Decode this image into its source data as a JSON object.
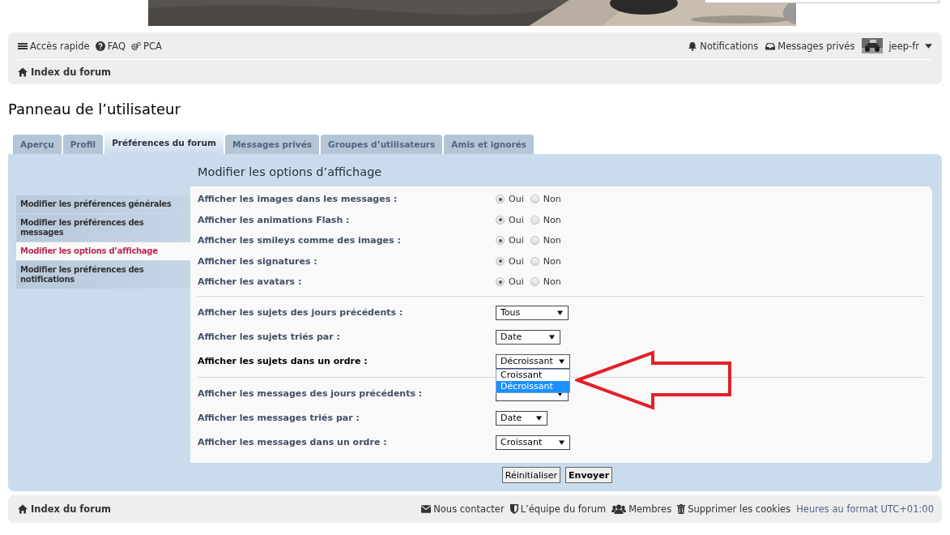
{
  "nav": {
    "quick_links": [
      {
        "label": "Accès rapide"
      },
      {
        "label": "FAQ"
      },
      {
        "label": "PCA"
      }
    ],
    "notifications": {
      "label": "Notifications"
    },
    "private_messages": {
      "label": "Messages privés"
    },
    "user": {
      "name": "jeep-fr"
    },
    "breadcrumb": "Index du forum"
  },
  "page_title": "Panneau de l’utilisateur",
  "tabs": [
    {
      "label": "Aperçu",
      "selected": false
    },
    {
      "label": "Profil",
      "selected": false
    },
    {
      "label": "Préférences du forum",
      "selected": true
    },
    {
      "label": "Messages privés",
      "selected": false
    },
    {
      "label": "Groupes d’utilisateurs",
      "selected": false
    },
    {
      "label": "Amis et ignorés",
      "selected": false
    }
  ],
  "sidebar": {
    "items": [
      {
        "label": "Modifier les préférences générales",
        "selected": false
      },
      {
        "label": "Modifier les préférences des messages",
        "selected": false
      },
      {
        "label": "Modifier les options d’affichage",
        "selected": true
      },
      {
        "label": "Modifier les préférences des notifications",
        "selected": false
      }
    ]
  },
  "heading": "Modifier les options d’affichage",
  "sections": [
    {
      "rows": [
        {
          "kind": "radio",
          "label": "Afficher les images dans les messages :",
          "options": [
            {
              "label": "Oui",
              "selected": true
            },
            {
              "label": "Non",
              "selected": false
            }
          ]
        },
        {
          "kind": "radio",
          "label": "Afficher les animations Flash :",
          "options": [
            {
              "label": "Oui",
              "selected": true
            },
            {
              "label": "Non",
              "selected": false
            }
          ]
        },
        {
          "kind": "radio",
          "label": "Afficher les smileys comme des images :",
          "options": [
            {
              "label": "Oui",
              "selected": true
            },
            {
              "label": "Non",
              "selected": false
            }
          ]
        },
        {
          "kind": "radio",
          "label": "Afficher les signatures :",
          "options": [
            {
              "label": "Oui",
              "selected": true
            },
            {
              "label": "Non",
              "selected": false
            }
          ]
        },
        {
          "kind": "radio",
          "label": "Afficher les avatars :",
          "options": [
            {
              "label": "Oui",
              "selected": true
            },
            {
              "label": "Non",
              "selected": false
            }
          ]
        }
      ]
    },
    {
      "rows": [
        {
          "kind": "select",
          "label": "Afficher les sujets des jours précédents :",
          "value": "Tous",
          "expanded": false
        },
        {
          "kind": "select",
          "label": "Afficher les sujets triés par :",
          "value": "Date",
          "expanded": false
        },
        {
          "kind": "select",
          "label": "Afficher les sujets dans un ordre :",
          "value": "Décroissant",
          "expanded": true,
          "options": [
            {
              "label": "Croissant",
              "selected": false
            },
            {
              "label": "Décroissant",
              "selected": true
            }
          ]
        }
      ]
    },
    {
      "rows": [
        {
          "kind": "select",
          "label": "Afficher les messages des jours précédents :",
          "expanded": false
        },
        {
          "kind": "select",
          "label": "Afficher les messages triés par :",
          "value": "Date",
          "expanded": false
        },
        {
          "kind": "select",
          "label": "Afficher les messages dans un ordre :",
          "value": "Croissant",
          "expanded": false
        }
      ]
    }
  ],
  "buttons": [
    {
      "label": "Réinitialiser",
      "kind": "reset"
    },
    {
      "label": "Envoyer",
      "kind": "submit"
    }
  ],
  "footer": {
    "breadcrumb": "Index du forum",
    "links": [
      {
        "label": "Nous contacter"
      },
      {
        "label": "L’équipe du forum"
      },
      {
        "label": "Membres"
      },
      {
        "label": "Supprimer les cookies"
      }
    ],
    "timezone": "Heures au format UTC+01:00"
  }
}
